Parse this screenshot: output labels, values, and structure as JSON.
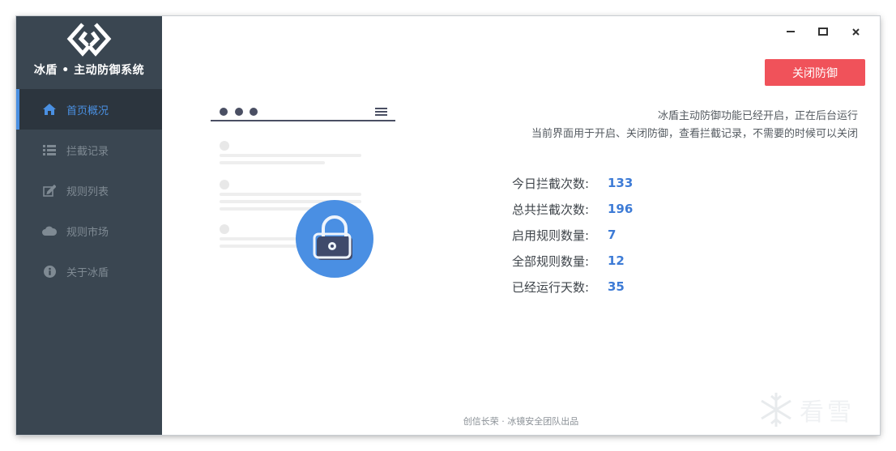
{
  "app": {
    "title": "冰盾 • 主动防御系统"
  },
  "sidebar": {
    "items": [
      {
        "label": "首页概况",
        "icon": "home-icon",
        "active": true
      },
      {
        "label": "拦截记录",
        "icon": "list-icon",
        "active": false
      },
      {
        "label": "规则列表",
        "icon": "edit-icon",
        "active": false
      },
      {
        "label": "规则市场",
        "icon": "cloud-icon",
        "active": false
      },
      {
        "label": "关于冰盾",
        "icon": "info-icon",
        "active": false
      }
    ]
  },
  "toolbar": {
    "close_defense_label": "关闭防御"
  },
  "description": {
    "line1": "冰盾主动防御功能已经开启，正在后台运行",
    "line2": "当前界面用于开启、关闭防御，查看拦截记录，不需要的时候可以关闭"
  },
  "stats": [
    {
      "label": "今日拦截次数:",
      "value": "133"
    },
    {
      "label": "总共拦截次数:",
      "value": "196"
    },
    {
      "label": "启用规则数量:",
      "value": "7"
    },
    {
      "label": "全部规则数量:",
      "value": "12"
    },
    {
      "label": "已经运行天数:",
      "value": "35"
    }
  ],
  "footer": {
    "text": "创信长荣 · 冰镜安全团队出品"
  },
  "watermark": {
    "text": "看雪"
  },
  "colors": {
    "sidebar_bg": "#3a4651",
    "active_bg": "#2c353e",
    "accent": "#4a90e2",
    "danger": "#f0525a",
    "stat_value": "#3d7bd6"
  }
}
